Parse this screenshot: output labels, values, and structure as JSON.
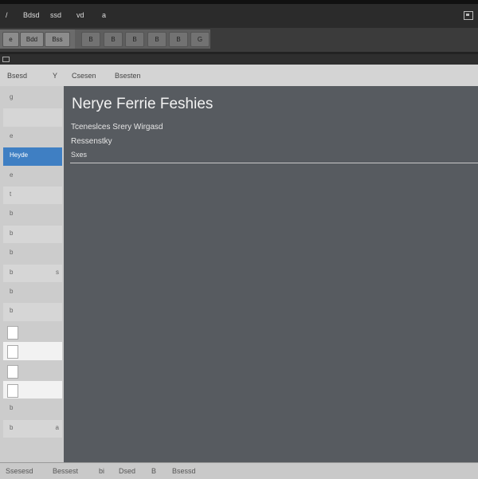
{
  "menubar": {
    "items": [
      "/",
      "Bdsd",
      "ssd",
      "vd",
      "a"
    ]
  },
  "toolbar": {
    "buttons": [
      "e",
      "Bdd",
      "Bss",
      "B",
      "B",
      "B",
      "B",
      "B",
      "G"
    ]
  },
  "header": {
    "items": [
      "Bsesd",
      "Y",
      "Csesen",
      "Bsesten"
    ]
  },
  "sidebar": {
    "rows": [
      {
        "label": "g"
      },
      {
        "label": ""
      },
      {
        "label": "e"
      },
      {
        "label": "Heyde",
        "selected": true
      },
      {
        "label": "e"
      },
      {
        "label": "t"
      },
      {
        "label": "b"
      },
      {
        "label": "b"
      },
      {
        "label": "b"
      },
      {
        "label": "b",
        "extra": "s"
      },
      {
        "label": "b"
      },
      {
        "label": "b"
      },
      {
        "label": ""
      },
      {
        "label": ""
      },
      {
        "label": ""
      },
      {
        "label": ""
      },
      {
        "label": "b"
      },
      {
        "label": "b",
        "extra": "a"
      }
    ]
  },
  "main": {
    "title": "Nerye Ferrie Feshies",
    "line1": "Tceneslces Srery Wirgasd",
    "line2": "Ressenstky",
    "line3": "Sxes"
  },
  "status": {
    "items": [
      "Ssesesd",
      "Bessest",
      "bi",
      "Dsed",
      "B",
      "Bsessd"
    ]
  }
}
